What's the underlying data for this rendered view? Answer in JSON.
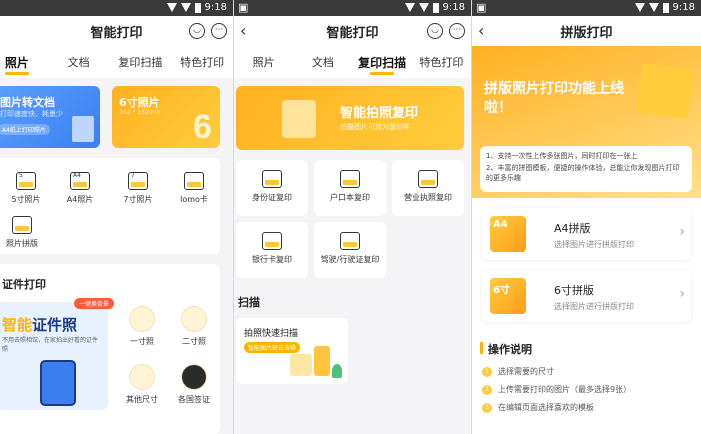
{
  "status": {
    "time": "9:18"
  },
  "p1": {
    "title": "智能打印",
    "tabs": [
      "照片",
      "文档",
      "复印扫描",
      "特色打印"
    ],
    "banner_left": {
      "title": "图片转文档",
      "sub": "打印速度快、耗墨少",
      "chip": "A4纸上打印照片"
    },
    "banner_right": {
      "title": "6寸照片",
      "sub": "102 * 152mm",
      "big": "6"
    },
    "grid": [
      {
        "label": "5寸照片",
        "num": "5"
      },
      {
        "label": "A4照片",
        "num": "A4"
      },
      {
        "label": "7寸照片",
        "num": "7"
      },
      {
        "label": "lomo卡",
        "num": ""
      },
      {
        "label": "照片拼版",
        "num": ""
      }
    ],
    "cert": {
      "section": "证件打印",
      "badge": "一键换背景",
      "heading_yellow": "智能",
      "heading_dark": "证件照",
      "desc": "不用去照相馆，在家拍出好看的证件照",
      "items": [
        "一寸照",
        "二寸照",
        "其他尺寸",
        "各国签证"
      ]
    }
  },
  "p2": {
    "title": "智能打印",
    "tabs": [
      "照片",
      "文档",
      "复印扫描",
      "特色打印"
    ],
    "banner": {
      "title": "智能拍照复印",
      "sub": "拍摄图片可转为复印件"
    },
    "tiles": [
      "身份证复印",
      "户口本复印",
      "营业执照复印",
      "银行卡复印",
      "驾驶/行驶证复印"
    ],
    "scan_section": "扫描",
    "scan_card": {
      "title": "拍照快速扫描",
      "chip": "智能图片矫正去噪"
    }
  },
  "p3": {
    "title": "拼版打印",
    "hero_title": "拼版照片打印功能上线啦！",
    "hero_lines": [
      "1、支持一次性上传多张图片，同时打印在一张上",
      "2、丰富的拼图模板，便捷的操作体验，总能让你发现图片打印的更多乐趣"
    ],
    "options": [
      {
        "thumb": "A4",
        "title": "A4拼版",
        "sub": "选择图片进行拼版打印"
      },
      {
        "thumb": "6寸",
        "title": "6寸拼版",
        "sub": "选择图片进行拼版打印"
      }
    ],
    "howto": "操作说明",
    "steps": [
      {
        "n": "1",
        "text": "选择需要的尺寸"
      },
      {
        "n": "2",
        "text": "上传需要打印的图片（最多选择9张）"
      },
      {
        "n": "3",
        "text": "在编辑页面选择喜欢的模板"
      }
    ]
  },
  "colors": {
    "accent": "#ffb400",
    "blue": "#4a8ef0",
    "orange": "#ff9b1a"
  }
}
